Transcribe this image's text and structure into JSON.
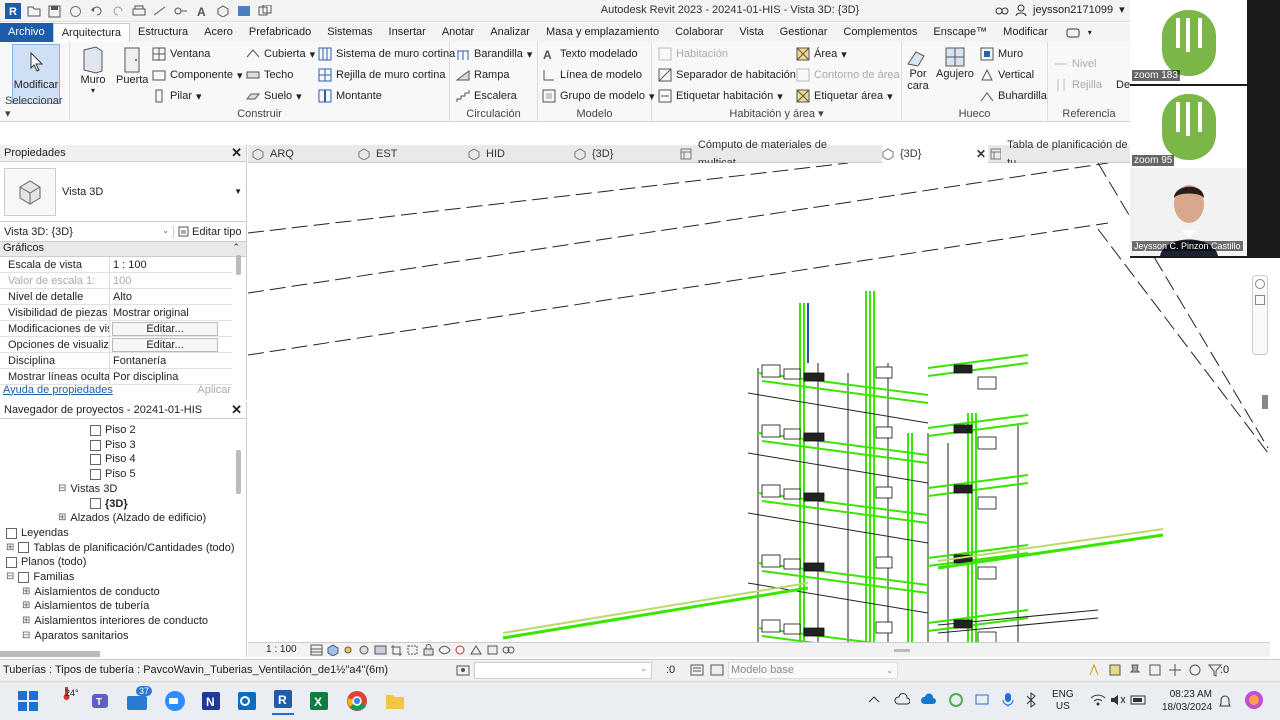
{
  "app": {
    "title": "Autodesk Revit 2023 - 20241-01-HIS - Vista 3D: {3D}",
    "user": "jeysson2171099",
    "user_caret": "▾"
  },
  "menu": {
    "tabs": [
      "Archivo",
      "Arquitectura",
      "Estructura",
      "Acero",
      "Prefabricado",
      "Sistemas",
      "Insertar",
      "Anotar",
      "Analizar",
      "Masa y emplazamiento",
      "Colaborar",
      "Vista",
      "Gestionar",
      "Complementos",
      "Enscape™",
      "Modificar"
    ]
  },
  "ribbon": {
    "seleccionar": {
      "label": "Seleccionar",
      "modificar": "Modificar"
    },
    "construir": {
      "label": "Construir",
      "muro": "Muro",
      "puerta": "Puerta",
      "ventana": "Ventana",
      "componente": "Componente",
      "pilar": "Pilar",
      "cubierta": "Cubierta",
      "techo": "Techo",
      "suelo": "Suelo",
      "sistema_muro": "Sistema de muro cortina",
      "rejilla_muro": "Rejilla de muro cortina",
      "montante": "Montante"
    },
    "circulacion": {
      "label": "Circulación",
      "barandilla": "Barandilla",
      "rampa": "Rampa",
      "escalera": "Escalera"
    },
    "modelo": {
      "label": "Modelo",
      "texto": "Texto modelado",
      "linea": "Línea de modelo",
      "grupo": "Grupo de modelo"
    },
    "habitacion": {
      "label": "Habitación y área",
      "habitacion": "Habitación",
      "separador": "Separador de habitación",
      "etiquetar_hab": "Etiquetar habitación",
      "area": "Área",
      "contorno": "Contorno de área",
      "etiquetar_area": "Etiquetar área"
    },
    "hueco": {
      "label": "Hueco",
      "por_cara": "Por",
      "por_cara2": "cara",
      "agujero": "Agujero",
      "muro": "Muro",
      "vertical": "Vertical",
      "buhardilla": "Buhardilla"
    },
    "referencia": {
      "label": "Referencia",
      "nivel": "Nivel",
      "rejilla": "Rejilla",
      "def": "De"
    }
  },
  "properties": {
    "header": "Propiedades",
    "type_name": "Vista 3D",
    "selector": "Vista 3D: {3D}",
    "edit_type": "Editar tipo",
    "section": "Gráficos",
    "rows": [
      {
        "k": "Escala de vista",
        "v": "1 : 100",
        "dis": false,
        "btn": false
      },
      {
        "k": "Valor de escala   1:",
        "v": "100",
        "dis": true,
        "btn": false
      },
      {
        "k": "Nivel de detalle",
        "v": "Alto",
        "dis": false,
        "btn": false
      },
      {
        "k": "Visibilidad de piezas",
        "v": "Mostrar original",
        "dis": false,
        "btn": false
      },
      {
        "k": "Modificaciones de vis...",
        "v": "Editar...",
        "dis": false,
        "btn": true
      },
      {
        "k": "Opciones de visualiza...",
        "v": "Editar...",
        "dis": false,
        "btn": true
      },
      {
        "k": "Disciplina",
        "v": "Fontanería",
        "dis": false,
        "btn": false
      },
      {
        "k": "Mostrar líneas ocultas",
        "v": "Por disciplina",
        "dis": false,
        "btn": false
      }
    ],
    "help": "Ayuda de propiedades",
    "apply": "Aplicar"
  },
  "browser": {
    "header": "Navegador de proyectos - 20241-01-HIS",
    "items": [
      {
        "label": "Piso 2",
        "indent": 90,
        "box": true,
        "exp": ""
      },
      {
        "label": "Piso 3",
        "indent": 90,
        "box": true,
        "exp": ""
      },
      {
        "label": "Piso 4",
        "indent": 90,
        "box": true,
        "exp": ""
      },
      {
        "label": "Piso 5",
        "indent": 90,
        "box": true,
        "exp": ""
      },
      {
        "label": "Vistas 3D",
        "indent": 58,
        "box": false,
        "exp": "⊟"
      },
      {
        "label": "{3D}",
        "indent": 90,
        "box": true,
        "exp": "",
        "bold": true
      },
      {
        "label": "Alzados (Alzado de edificio)",
        "indent": 58,
        "box": false,
        "exp": "⊞"
      },
      {
        "label": "Leyendas",
        "indent": 6,
        "box": true,
        "exp": ""
      },
      {
        "label": "Tablas de planificación/Cantidades (todo)",
        "indent": 6,
        "box": true,
        "exp": "⊞"
      },
      {
        "label": "Planos (todo)",
        "indent": 6,
        "box": true,
        "exp": ""
      },
      {
        "label": "Familias",
        "indent": 6,
        "box": true,
        "exp": "⊟"
      },
      {
        "label": "Aislamientos de conducto",
        "indent": 22,
        "box": false,
        "exp": "⊞"
      },
      {
        "label": "Aislamientos de tubería",
        "indent": 22,
        "box": false,
        "exp": "⊞"
      },
      {
        "label": "Aislamientos interiores de conducto",
        "indent": 22,
        "box": false,
        "exp": "⊞"
      },
      {
        "label": "Aparatos sanitarios",
        "indent": 22,
        "box": false,
        "exp": "⊟"
      }
    ]
  },
  "viewtabs": [
    {
      "label": "ARQ",
      "active": false
    },
    {
      "label": "EST",
      "active": false
    },
    {
      "label": "HID",
      "active": false
    },
    {
      "label": "{3D}",
      "active": false
    },
    {
      "label": "Cómputo de materiales de multicat...",
      "active": false
    },
    {
      "label": "{3D}",
      "active": true
    },
    {
      "label": "Tabla de planificación de tu",
      "active": false
    }
  ],
  "viewbar": {
    "scale": "1 : 100"
  },
  "status": {
    "text": "Tuberías : Tipos de tubería : PavcoWavin_Tuberias_Ventilación_de1½\"a4\"(6m)",
    "sel_count": ":0",
    "model": "Modelo base",
    "filter_count": ":0"
  },
  "taskbar": {
    "weather": "24°",
    "mail_badge": "37",
    "lang1": "ENG",
    "lang2": "US",
    "time": "08:23 AM",
    "date": "18/03/2024"
  },
  "webcam": {
    "zoom1": "zoom 183",
    "zoom2": "zoom 95",
    "person": "Jeysson C. Pinzon Castillo",
    "logo_text": "UIS"
  },
  "colors": {
    "accent_blue": "#1d5ca8",
    "pipe_green": "#39e600",
    "logo_green": "#7ab648"
  }
}
